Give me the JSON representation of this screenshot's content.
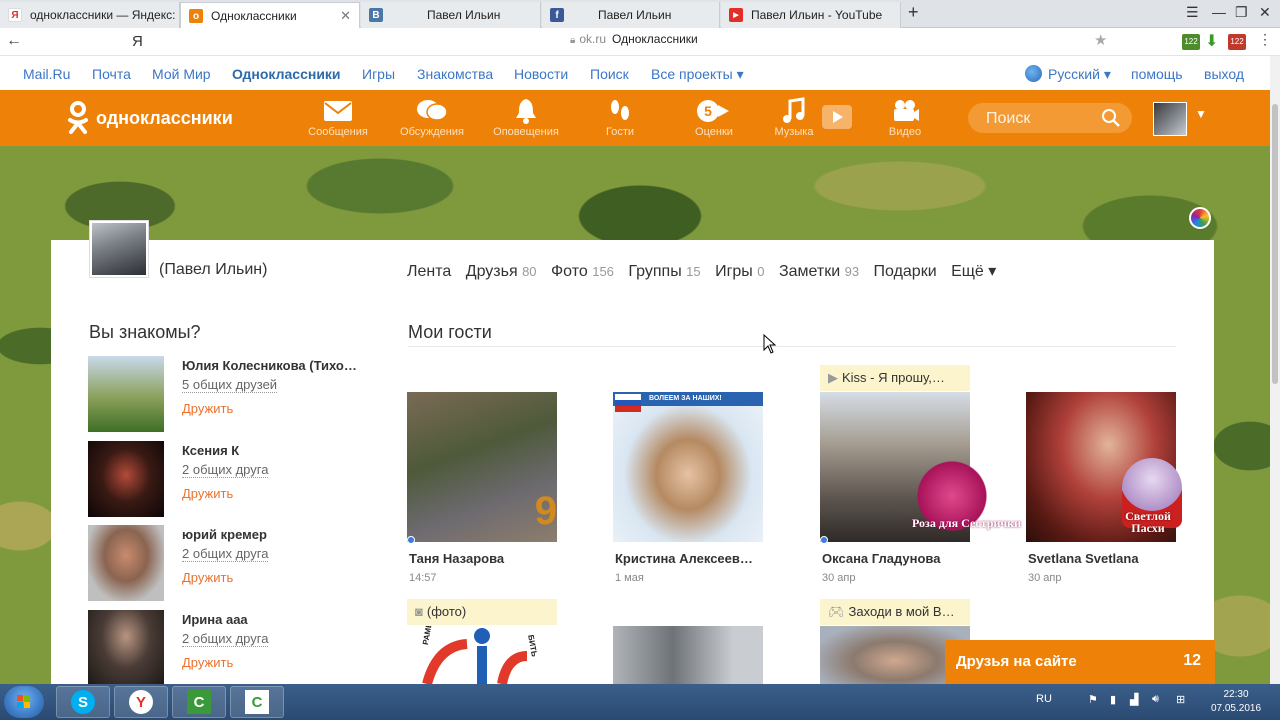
{
  "browser": {
    "tabs": [
      {
        "title": "одноклассники — Яндекс: н",
        "fav": "Я",
        "color": "#e02f2f"
      },
      {
        "title": "Одноклассники",
        "fav": "о",
        "color": "#ee8208"
      },
      {
        "title": "Павел Ильин",
        "fav": "В",
        "color": "#4a76a8"
      },
      {
        "title": "Павел Ильин",
        "fav": "f",
        "color": "#3b5998"
      },
      {
        "title": "Павел Ильин - YouTube",
        "fav": "▶",
        "color": "#e52d27"
      }
    ],
    "yandex_letter": "Я",
    "address_domain": "ok.ru",
    "address_title": "Одноклассники",
    "badge_text": "122"
  },
  "portal": {
    "links": [
      "Mail.Ru",
      "Почта",
      "Мой Мир",
      "Одноклассники",
      "Игры",
      "Знакомства",
      "Новости",
      "Поиск",
      "Все проекты ▾"
    ],
    "language": "Русский ▾",
    "help": "помощь",
    "logout": "выход"
  },
  "okheader": {
    "logo_text": "одноклассники",
    "nav": [
      {
        "label": "Сообщения",
        "icon": "envelope-icon"
      },
      {
        "label": "Обсуждения",
        "icon": "speech-bubbles-icon"
      },
      {
        "label": "Оповещения",
        "icon": "bell-icon"
      },
      {
        "label": "Гости",
        "icon": "footprints-icon"
      },
      {
        "label": "Оценки",
        "icon": "rating-five-icon"
      },
      {
        "label": "Музыка",
        "icon": "music-note-icon"
      },
      {
        "label": "Видео",
        "icon": "video-camera-icon"
      }
    ],
    "search_placeholder": "Поиск"
  },
  "profile": {
    "name": "(Павел Ильин)",
    "menu": [
      {
        "label": "Лента",
        "count": ""
      },
      {
        "label": "Друзья",
        "count": "80"
      },
      {
        "label": "Фото",
        "count": "156"
      },
      {
        "label": "Группы",
        "count": "15"
      },
      {
        "label": "Игры",
        "count": "0"
      },
      {
        "label": "Заметки",
        "count": "93"
      },
      {
        "label": "Подарки",
        "count": ""
      },
      {
        "label": "Ещё ▾",
        "count": ""
      }
    ]
  },
  "suggestions": {
    "title": "Вы знакомы?",
    "add_label": "Дружить",
    "items": [
      {
        "name": "Юлия Колесникова (Тихо…",
        "mutual": "5 общих друзей"
      },
      {
        "name": "Ксения К",
        "mutual": "2 общих друга"
      },
      {
        "name": "юрий кремер",
        "mutual": "2 общих друга"
      },
      {
        "name": "Ирина ааа",
        "mutual": "2 общих друга"
      }
    ]
  },
  "guests": {
    "title": "Мои гости",
    "items": [
      {
        "name": "Таня Назарова",
        "time": "14:57",
        "online": true,
        "status": ""
      },
      {
        "name": "Кристина Алексеев…",
        "time": "1 мая",
        "online": false,
        "status": "",
        "overlay": "ВОЛЕЕМ ЗА НАШИХ!"
      },
      {
        "name": "Оксана Гладунова",
        "time": "30 апр",
        "online": true,
        "status": "Kiss - Я прошу,…",
        "overlay": "Роза для Сестрички"
      },
      {
        "name": "Svetlana Svetlana",
        "time": "30 апр",
        "online": false,
        "status": "",
        "overlay": "Светлой Пасхи"
      }
    ],
    "row2_status": [
      {
        "status": "(фото)",
        "icon": "camera-icon"
      },
      {
        "status": "Заходи в мой В…",
        "icon": "gamepad-icon"
      }
    ],
    "row2_overlays": [
      "РАМЕ",
      "БИТЬ"
    ]
  },
  "friends_online": {
    "label": "Друзья на сайте",
    "count": "12"
  },
  "taskbar": {
    "lang": "RU",
    "time": "22:30",
    "date": "07.05.2016"
  }
}
